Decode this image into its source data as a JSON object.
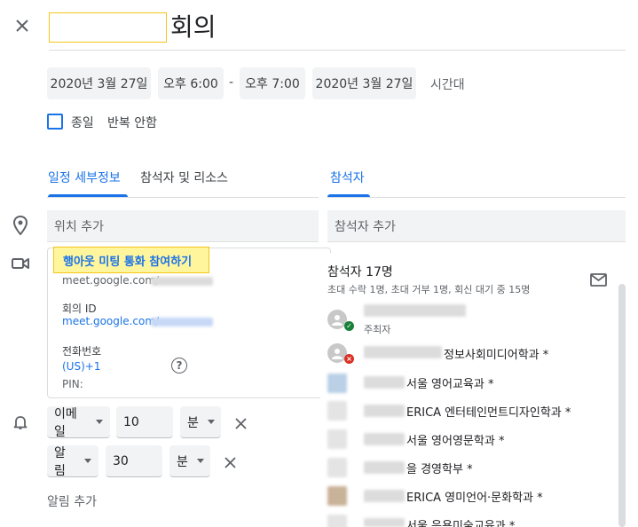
{
  "header": {
    "close_icon": "close-icon",
    "title_suffix": "회의"
  },
  "datetime": {
    "start_date": "2020년 3월 27일",
    "start_time": "오후 6:00",
    "separator": "-",
    "end_time": "오후 7:00",
    "end_date": "2020년 3월 27일",
    "timezone_label": "시간대"
  },
  "options": {
    "all_day_label": "종일",
    "all_day_checked": false,
    "repeat_label": "반복 안함"
  },
  "tabs": {
    "details": "일정 세부정보",
    "guests_resources": "참석자 및 리소스",
    "guests": "참석자"
  },
  "location": {
    "placeholder": "위치 추가",
    "icon": "location-pin-icon"
  },
  "meet": {
    "icon": "video-camera-icon",
    "join_label": "행아웃 미팅 통화 참여하기",
    "link_prefix": "meet.google.com/",
    "meeting_id_label": "회의 ID",
    "meeting_id_prefix": "meet.google.com/",
    "phone_label": "전화번호",
    "phone_country": "(US)+1",
    "pin_label": "PIN:",
    "help_icon": "help-icon"
  },
  "notifications": {
    "bell_icon": "bell-icon",
    "items": [
      {
        "type": "이메일",
        "value": "10",
        "unit": "분"
      },
      {
        "type": "알림",
        "value": "30",
        "unit": "분"
      }
    ],
    "add_label": "알림 추가"
  },
  "guests": {
    "add_placeholder": "참석자 추가",
    "count_label": "참석자 17명",
    "summary": "초대 수락 1명, 초대 거부 1명, 회신 대기 중 15명",
    "email_icon": "email-icon",
    "list": [
      {
        "name": "",
        "role": "주최자",
        "status": "accepted"
      },
      {
        "name": "정보사회미디어학과 *",
        "status": "declined"
      },
      {
        "name": "서울 영어교육과 *"
      },
      {
        "name": "ERICA 엔터테인먼트디자인학과 *"
      },
      {
        "name": "서울 영어영문학과 *"
      },
      {
        "name": "을 경영학부 *"
      },
      {
        "name": "ERICA 영미언어·문화학과 *"
      },
      {
        "name": "서울 응용미술교육과 *"
      }
    ]
  },
  "colors": {
    "accent": "#1a73e8",
    "highlight": "#fff59d",
    "accepted": "#188038",
    "declined": "#d93025"
  }
}
